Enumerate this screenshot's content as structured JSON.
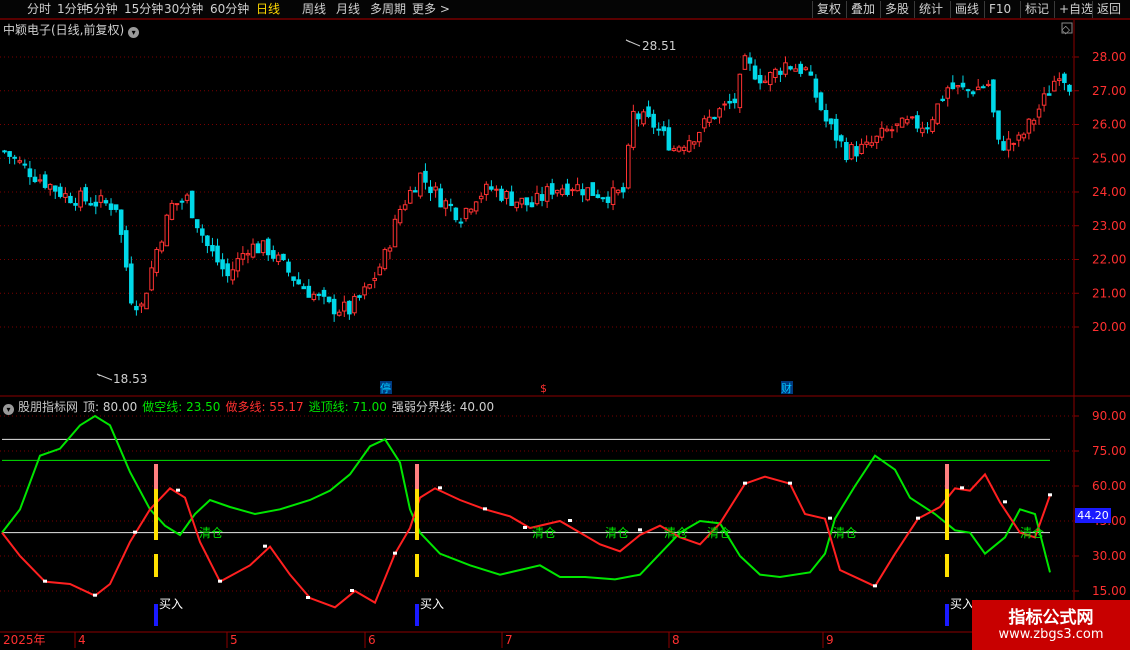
{
  "toolbar": {
    "periods": [
      "分时",
      "1分钟",
      "5分钟",
      "15分钟",
      "30分钟",
      "60分钟",
      "日线",
      "周线",
      "月线",
      "多周期",
      "更多"
    ],
    "active": "日线",
    "right_buttons": [
      "复权",
      "叠加",
      "多股",
      "统计",
      "画线",
      "F10",
      "标记",
      "+自选",
      "返回"
    ]
  },
  "main": {
    "title": "中颖电子(日线,前复权)",
    "high_label": "28.51",
    "low_label": "18.53",
    "events": [
      "停",
      "$",
      "财"
    ],
    "y_ticks": [
      "28.00",
      "27.00",
      "26.00",
      "25.00",
      "24.00",
      "23.00",
      "22.00",
      "21.00",
      "20.00"
    ]
  },
  "indicator": {
    "name": "股朋指标网",
    "params": [
      {
        "label": "顶:",
        "value": "80.00",
        "color": "#d0d0d0"
      },
      {
        "label": "做空线:",
        "value": "23.50",
        "color": "#00e600"
      },
      {
        "label": "做多线:",
        "value": "55.17",
        "color": "#ff3030"
      },
      {
        "label": "逃顶线:",
        "value": "71.00",
        "color": "#00e600"
      },
      {
        "label": "强弱分界线:",
        "value": "40.00",
        "color": "#d0d0d0"
      }
    ],
    "y_ticks": [
      "90.00",
      "75.00",
      "60.00",
      "45.00",
      "30.00",
      "15.00"
    ],
    "current_value": "44.20",
    "signal_buy": "买入",
    "signal_clear": "清仓"
  },
  "x_axis": {
    "year_label": "2025年",
    "months": [
      "4",
      "5",
      "6",
      "7",
      "8",
      "9"
    ]
  },
  "watermark": {
    "title": "指标公式网",
    "url": "www.zbgs3.com"
  },
  "colors": {
    "up": "#ff3232",
    "down": "#00d8e8",
    "green_line": "#00e600",
    "red_line": "#ff2020"
  }
}
